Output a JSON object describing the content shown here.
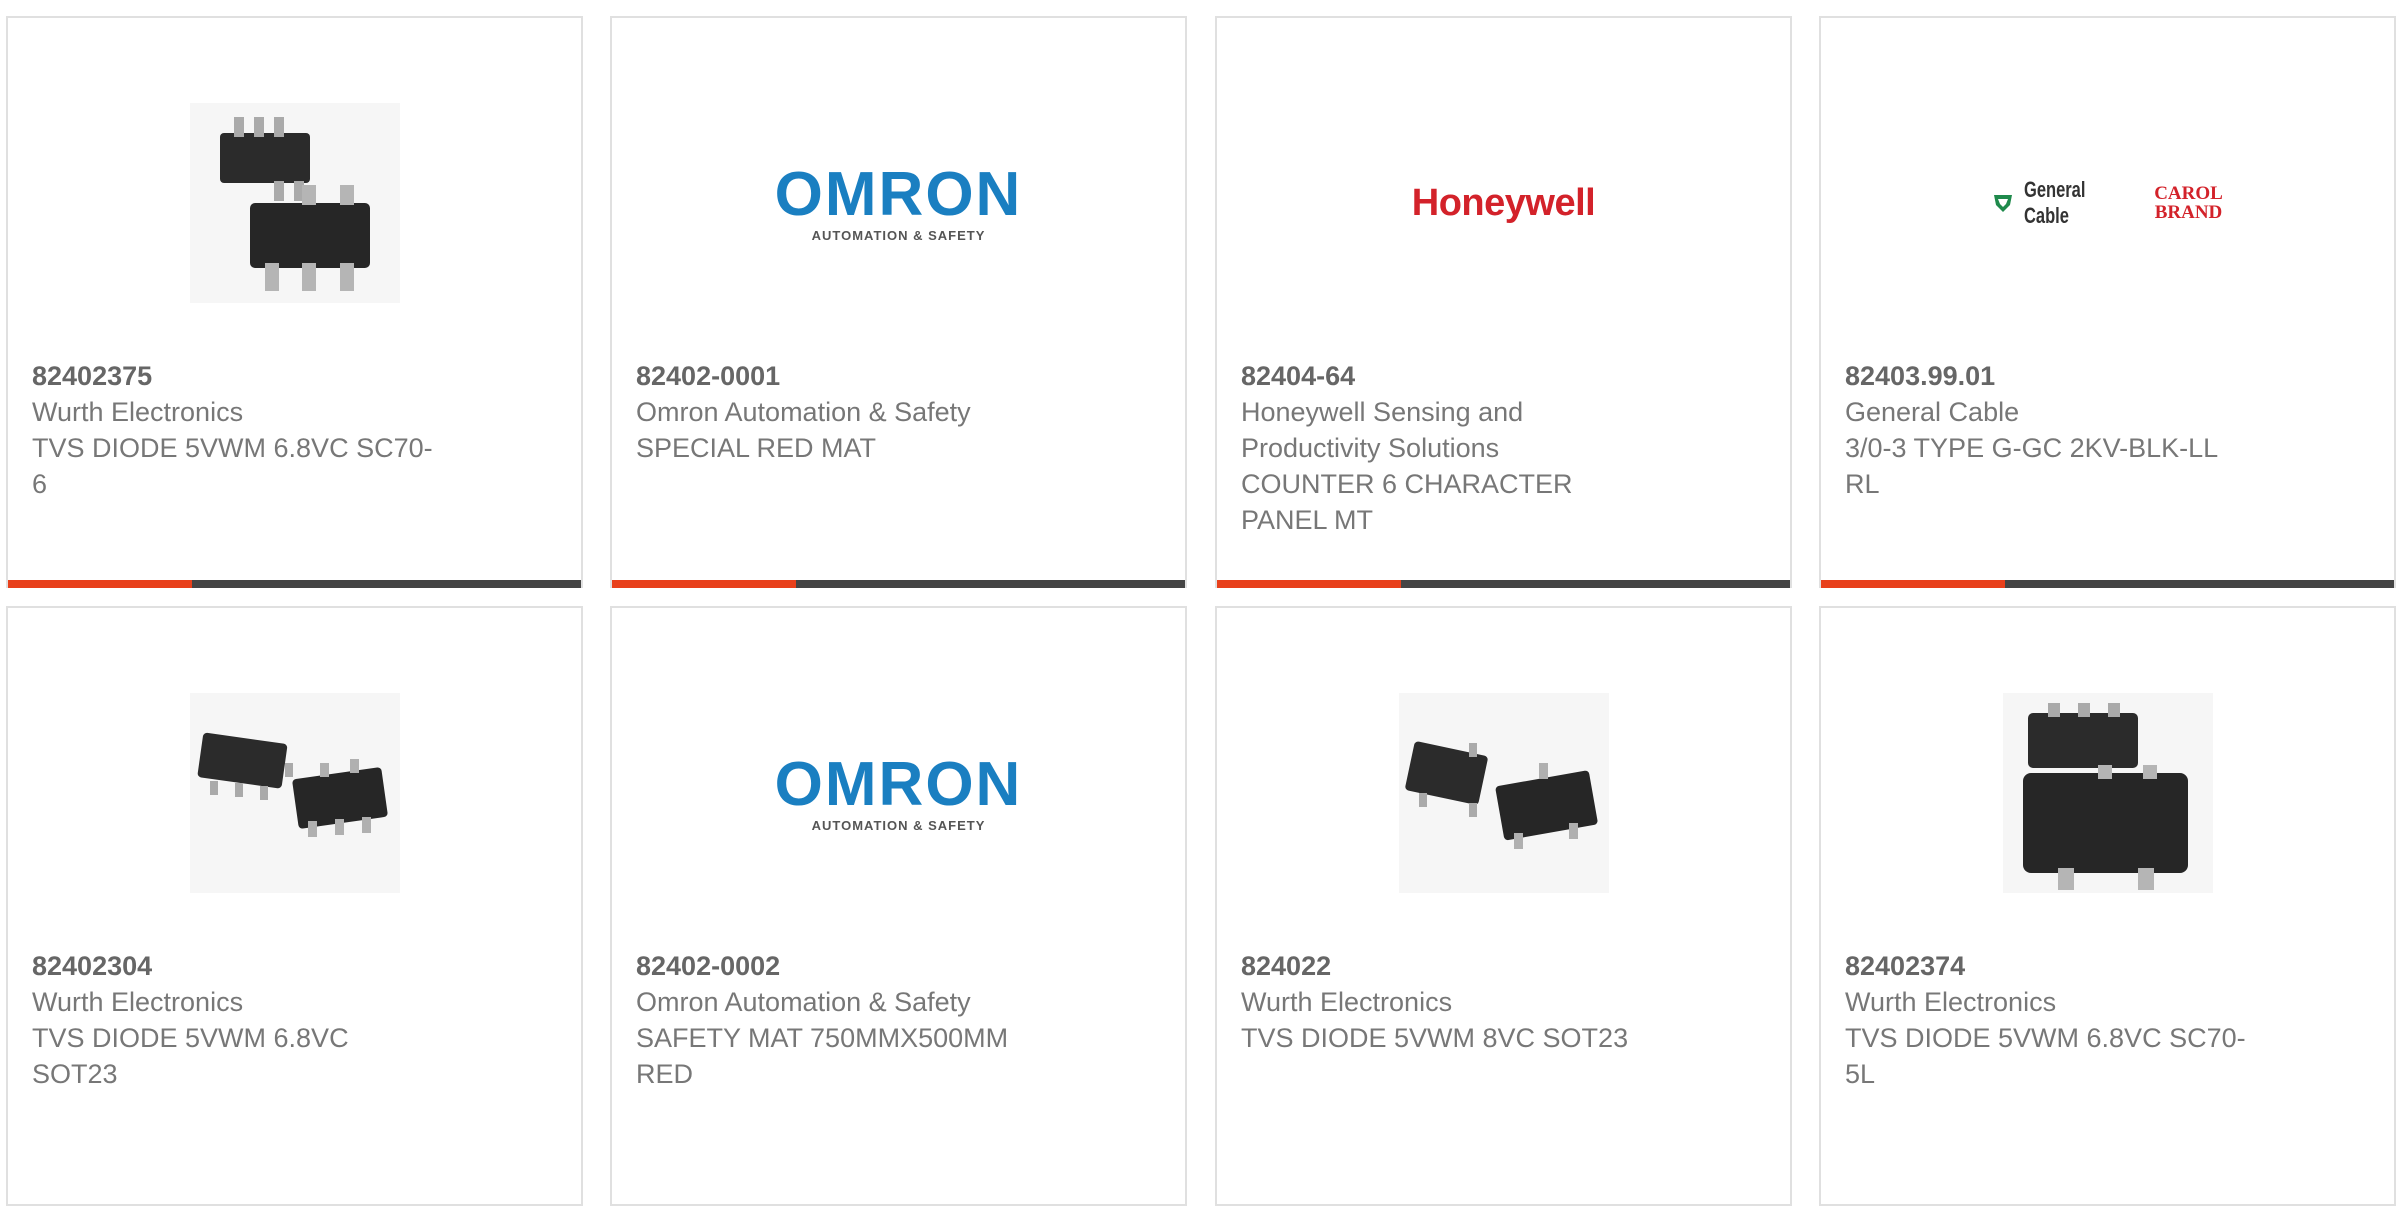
{
  "products": [
    {
      "part": "82402375",
      "manufacturer": "Wurth Electronics",
      "description": "TVS DIODE 5VWM 6.8VC SC70-",
      "description2": "6",
      "logo": "sc70-6-chip-image"
    },
    {
      "part": "82402-0001",
      "manufacturer": "Omron Automation & Safety",
      "description": "SPECIAL RED MAT",
      "description2": "",
      "logo": "omron-logo",
      "logo_text": "OMRON",
      "logo_sub": "AUTOMATION & SAFETY"
    },
    {
      "part": "82404-64",
      "manufacturer": "Honeywell Sensing and",
      "manufacturer2": "Productivity Solutions",
      "description": "COUNTER 6 CHARACTER",
      "description2": "PANEL MT",
      "logo": "honeywell-logo",
      "logo_text": "Honeywell"
    },
    {
      "part": "82403.99.01",
      "manufacturer": "General Cable",
      "description": "3/0-3 TYPE G-GC 2KV-BLK-LL",
      "description2": "RL",
      "logo": "general-cable-logo",
      "logo_text": "General Cable",
      "logo_text2": "CAROL",
      "logo_text3": "BRAND"
    },
    {
      "part": "82402304",
      "manufacturer": "Wurth Electronics",
      "description": "TVS DIODE 5VWM 6.8VC",
      "description2": "SOT23",
      "logo": "sot23-chip-image"
    },
    {
      "part": "82402-0002",
      "manufacturer": "Omron Automation & Safety",
      "description": "SAFETY MAT 750MMX500MM",
      "description2": "RED",
      "logo": "omron-logo",
      "logo_text": "OMRON",
      "logo_sub": "AUTOMATION & SAFETY"
    },
    {
      "part": "824022",
      "manufacturer": "Wurth Electronics",
      "description": "TVS DIODE 5VWM 8VC SOT23",
      "description2": "",
      "logo": "sot23-3-chip-image"
    },
    {
      "part": "82402374",
      "manufacturer": "Wurth Electronics",
      "description": "TVS DIODE 5VWM 6.8VC SC70-",
      "description2": "5L",
      "logo": "sc70-5-chip-image"
    }
  ],
  "colors": {
    "accent": "#e8401b",
    "bar": "#444444",
    "omron_blue": "#1a7fc1",
    "honeywell_red": "#d3222a"
  }
}
